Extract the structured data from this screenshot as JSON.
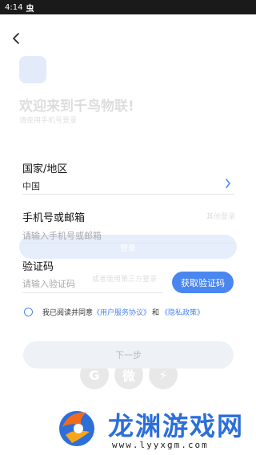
{
  "status_bar": {
    "time": "4:14",
    "indicator": "虫"
  },
  "background": {
    "title": "欢迎来到千鸟物联!",
    "subtitle": "请使用手机号登录",
    "pill_label": "登录",
    "other_login": "其他登录",
    "or_text": "或者使用第三方登录",
    "social_icons": [
      "G",
      "微",
      "⚡"
    ]
  },
  "form": {
    "region_label": "国家/地区",
    "region_value": "中国",
    "phone_label": "手机号或邮箱",
    "phone_placeholder": "请输入手机号或邮箱",
    "code_label": "验证码",
    "code_placeholder": "请输入验证码",
    "get_code_button": "获取验证码",
    "agree_prefix": "我已阅读并同意",
    "user_agreement": "《用户服务协议》",
    "agree_and": "和",
    "privacy_policy": "《隐私政策》",
    "next_button": "下一步"
  },
  "watermark": {
    "brand": "龙渊游戏网",
    "url": "www.lyyxgm.com"
  },
  "colors": {
    "accent": "#4a86f0",
    "statusbar": "#1a1a1a",
    "disabled_bg": "#eef1f6"
  }
}
